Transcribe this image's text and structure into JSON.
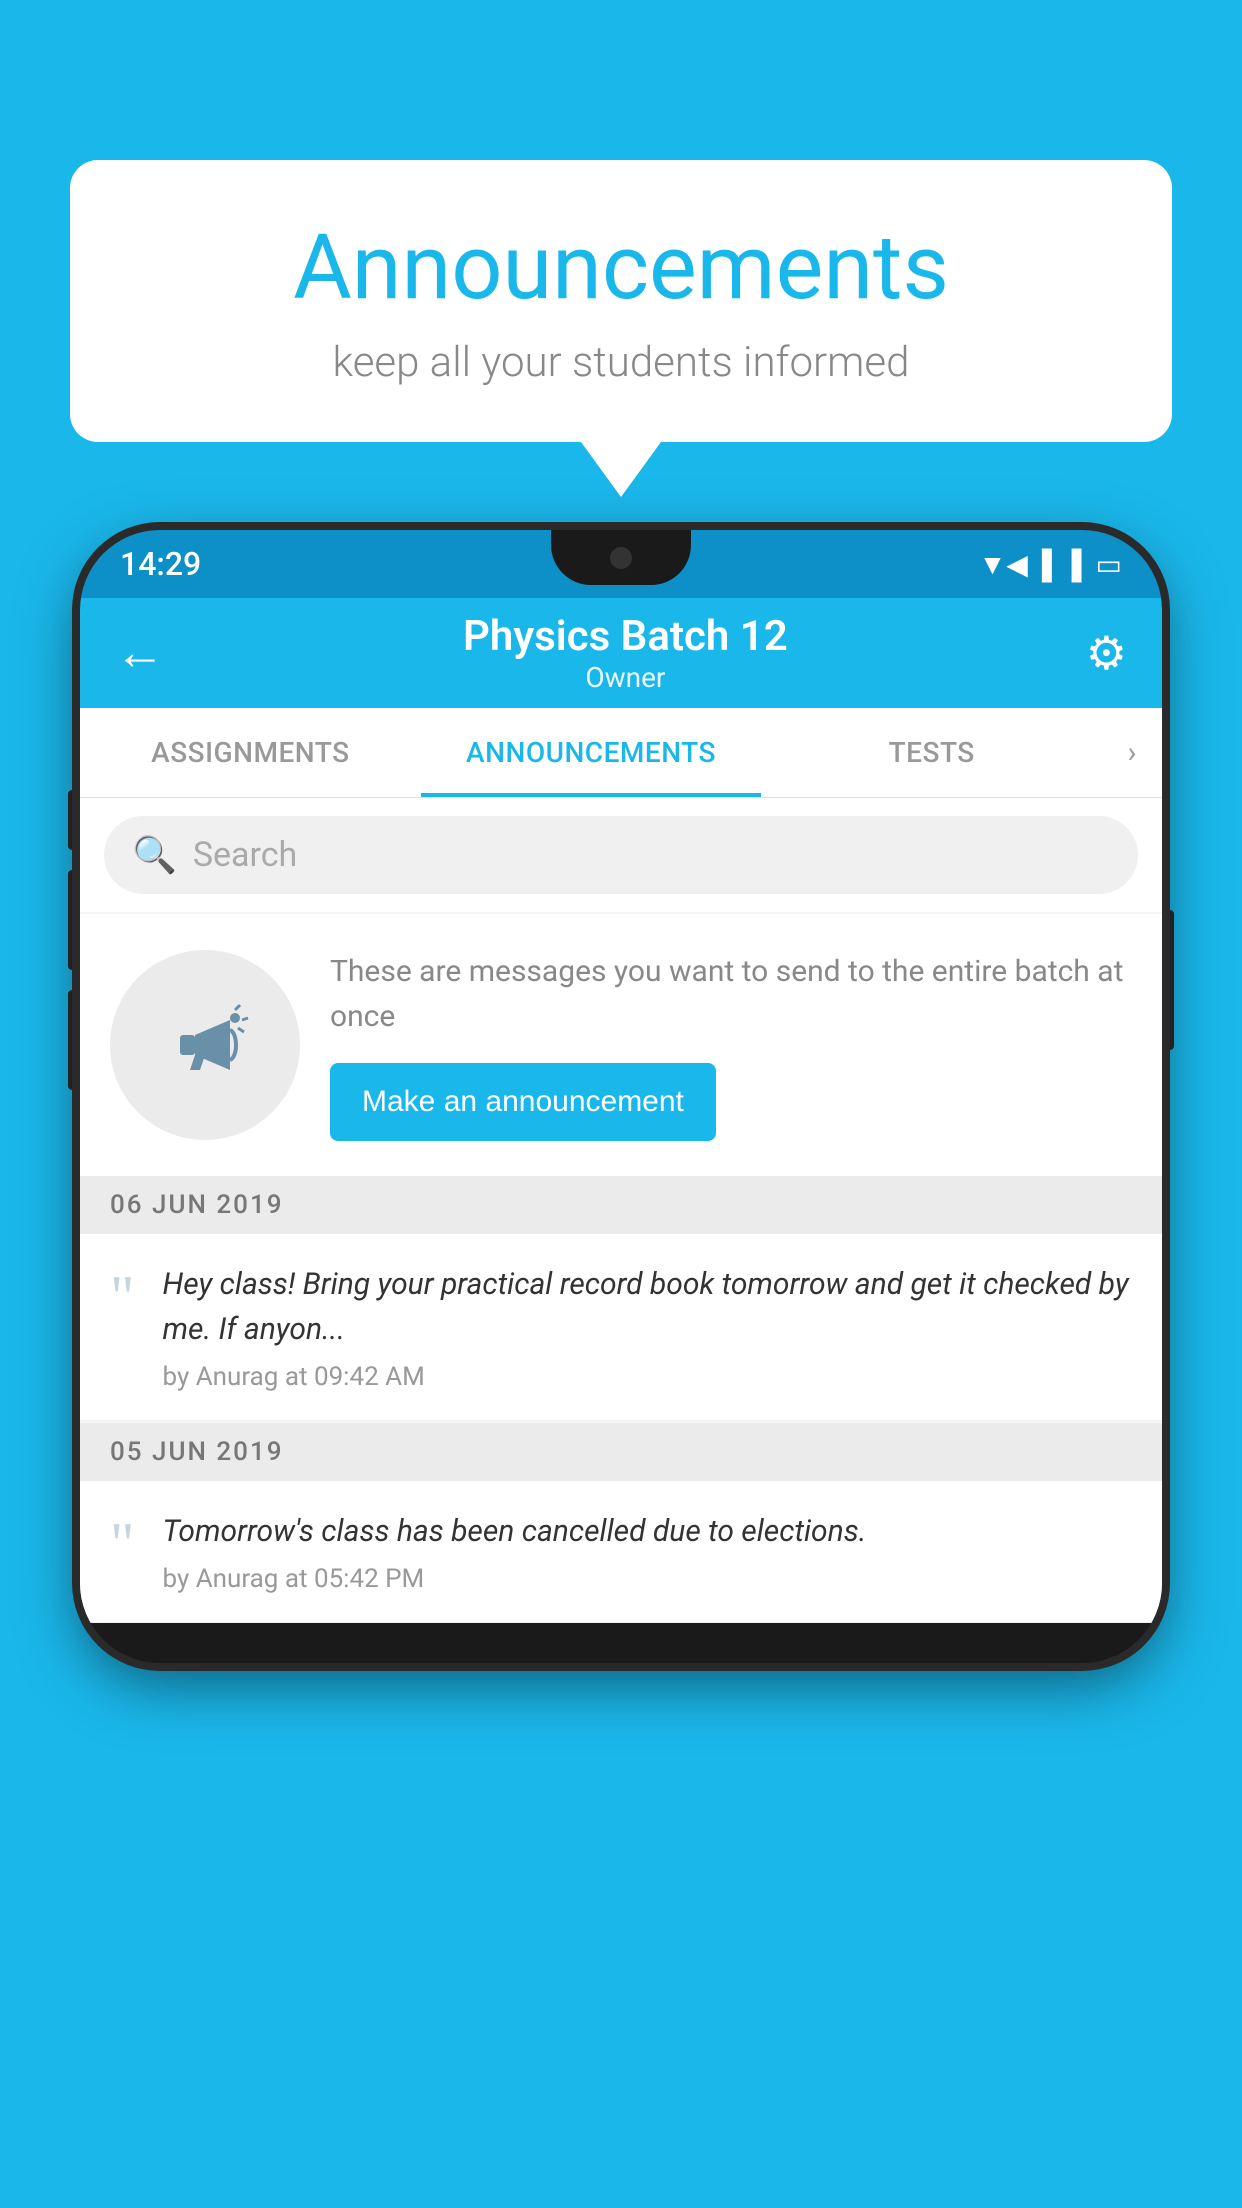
{
  "bubble": {
    "title": "Announcements",
    "subtitle": "keep all your students informed"
  },
  "phone": {
    "status_bar": {
      "time": "14:29",
      "icons": [
        "wifi",
        "signal",
        "battery"
      ]
    },
    "app_bar": {
      "title": "Physics Batch 12",
      "subtitle": "Owner",
      "back_label": "←",
      "gear_label": "⚙"
    },
    "tabs": [
      {
        "label": "ASSIGNMENTS",
        "active": false
      },
      {
        "label": "ANNOUNCEMENTS",
        "active": true
      },
      {
        "label": "TESTS",
        "active": false
      }
    ],
    "search": {
      "placeholder": "Search"
    },
    "promo": {
      "description": "These are messages you want to send to the entire batch at once",
      "button_label": "Make an announcement"
    },
    "announcements": [
      {
        "date": "06  JUN  2019",
        "message": "Hey class! Bring your practical record book tomorrow and get it checked by me. If anyon...",
        "meta": "by Anurag at 09:42 AM"
      },
      {
        "date": "05  JUN  2019",
        "message": "Tomorrow's class has been cancelled due to elections.",
        "meta": "by Anurag at 05:42 PM"
      }
    ]
  },
  "colors": {
    "primary": "#1ab7ea",
    "dark": "#1a1a1a",
    "white": "#ffffff",
    "light_gray": "#f5f5f5"
  }
}
